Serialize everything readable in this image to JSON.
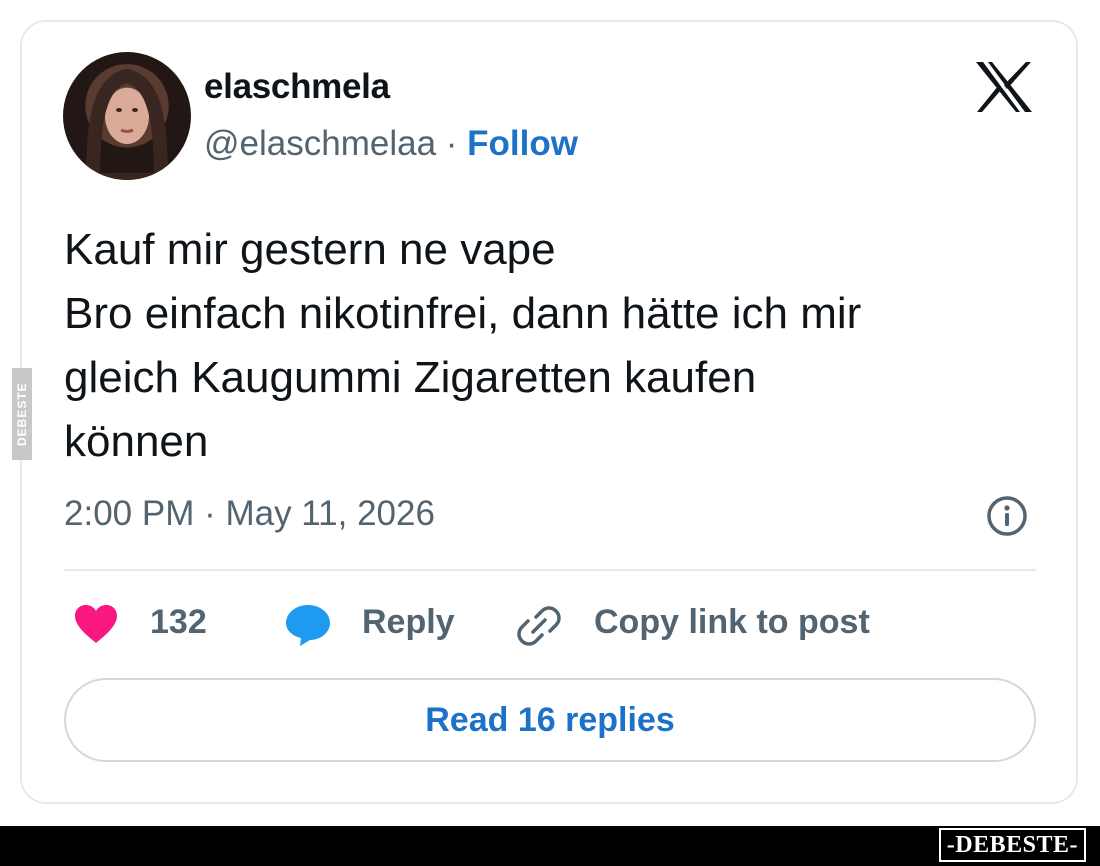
{
  "tweet": {
    "display_name": "elaschmela",
    "handle": "@elaschmelaa",
    "separator": " · ",
    "follow_label": "Follow",
    "text_lines": [
      "Kauf mir gestern ne vape",
      "Bro einfach nikotinfrei, dann hätte ich mir",
      "gleich Kaugummi Zigaretten kaufen",
      "können"
    ],
    "timestamp": "2:00 PM · May 11, 2026",
    "likes": "132",
    "reply_label": "Reply",
    "copy_link_label": "Copy link to post",
    "read_replies_label": "Read 16 replies"
  },
  "icons": {
    "brand": "x-logo-icon",
    "info": "info-icon",
    "like": "heart-icon",
    "reply": "reply-bubble-icon",
    "link": "link-icon"
  },
  "watermark": {
    "side_text": "DEBESTE",
    "brand_text": "-DEBESTE-"
  },
  "colors": {
    "text": "#0f1419",
    "secondary": "#536471",
    "link_blue": "#1d72c8",
    "heart": "#f91880",
    "reply_blue": "#1d9bf0",
    "border": "#e6e9ec"
  }
}
